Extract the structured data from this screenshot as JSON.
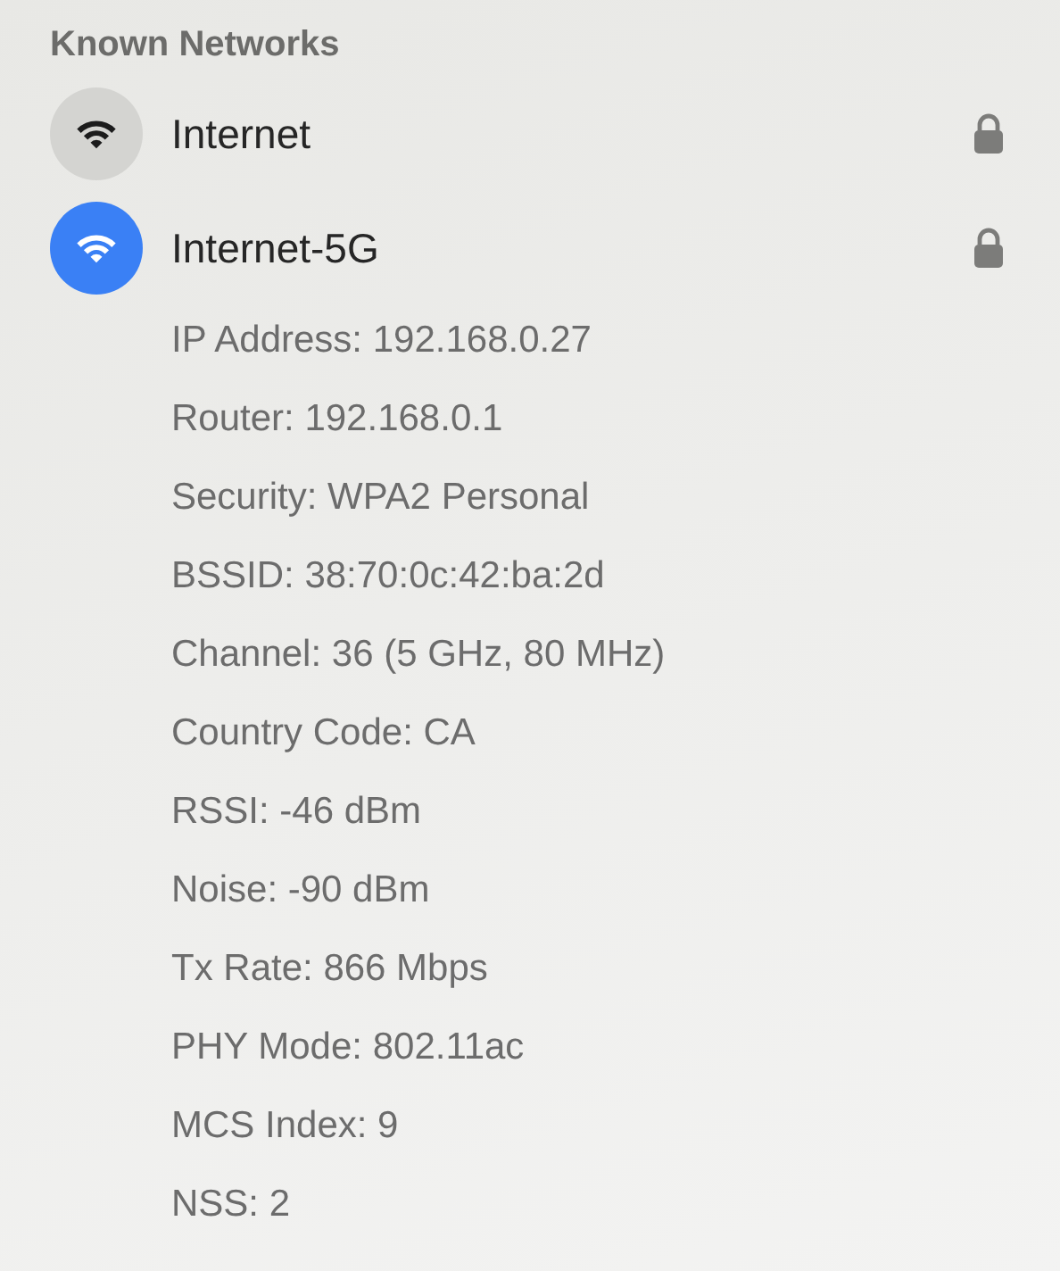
{
  "section_title": "Known Networks",
  "networks": [
    {
      "name": "Internet",
      "connected": false,
      "locked": true
    },
    {
      "name": "Internet-5G",
      "connected": true,
      "locked": true,
      "details": [
        "IP Address: 192.168.0.27",
        "Router: 192.168.0.1",
        "Security: WPA2 Personal",
        "BSSID: 38:70:0c:42:ba:2d",
        "Channel: 36 (5 GHz, 80 MHz)",
        "Country Code: CA",
        "RSSI: -46 dBm",
        "Noise: -90 dBm",
        "Tx Rate: 866 Mbps",
        "PHY Mode: 802.11ac",
        "MCS Index: 9",
        "NSS: 2"
      ]
    }
  ]
}
